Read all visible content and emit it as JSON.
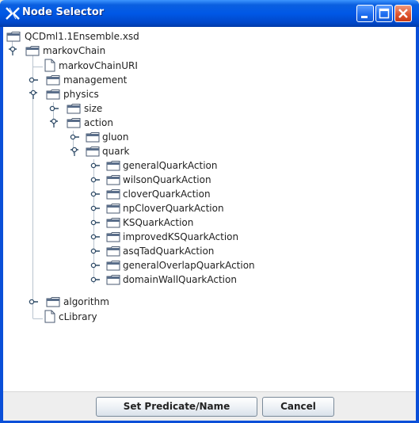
{
  "window": {
    "title": "Node Selector",
    "controls": [
      "minimize",
      "maximize",
      "close"
    ]
  },
  "tree": {
    "root": "QCDml1.1Ensemble.xsd",
    "nodes": [
      {
        "label": "markovChain",
        "type": "folder",
        "expanded": true
      },
      {
        "label": "markovChainURI",
        "type": "document"
      },
      {
        "label": "management",
        "type": "folder",
        "expanded": false
      },
      {
        "label": "physics",
        "type": "folder",
        "expanded": true
      },
      {
        "label": "size",
        "type": "folder",
        "expanded": false
      },
      {
        "label": "action",
        "type": "folder",
        "expanded": true
      },
      {
        "label": "gluon",
        "type": "folder",
        "expanded": false
      },
      {
        "label": "quark",
        "type": "folder",
        "expanded": true
      },
      {
        "label": "generalQuarkAction",
        "type": "folder",
        "expanded": false
      },
      {
        "label": "wilsonQuarkAction",
        "type": "folder",
        "expanded": false
      },
      {
        "label": "cloverQuarkAction",
        "type": "folder",
        "expanded": false
      },
      {
        "label": "npCloverQuarkAction",
        "type": "folder",
        "expanded": false
      },
      {
        "label": "KSQuarkAction",
        "type": "folder",
        "expanded": false
      },
      {
        "label": "improvedKSQuarkAction",
        "type": "folder",
        "expanded": false
      },
      {
        "label": "asqTadQuarkAction",
        "type": "folder",
        "expanded": false
      },
      {
        "label": "generalOverlapQuarkAction",
        "type": "folder",
        "expanded": false
      },
      {
        "label": "domainWallQuarkAction",
        "type": "folder",
        "expanded": false
      },
      {
        "label": "algorithm",
        "type": "folder",
        "expanded": false
      },
      {
        "label": "cLibrary",
        "type": "document"
      }
    ]
  },
  "buttons": {
    "set_predicate": "Set Predicate/Name",
    "cancel": "Cancel"
  },
  "colors": {
    "title_bar": "#0058e6",
    "frame": "#0a4fd8",
    "close_button": "#e05530",
    "folder_tab": "#5a6e8a"
  }
}
